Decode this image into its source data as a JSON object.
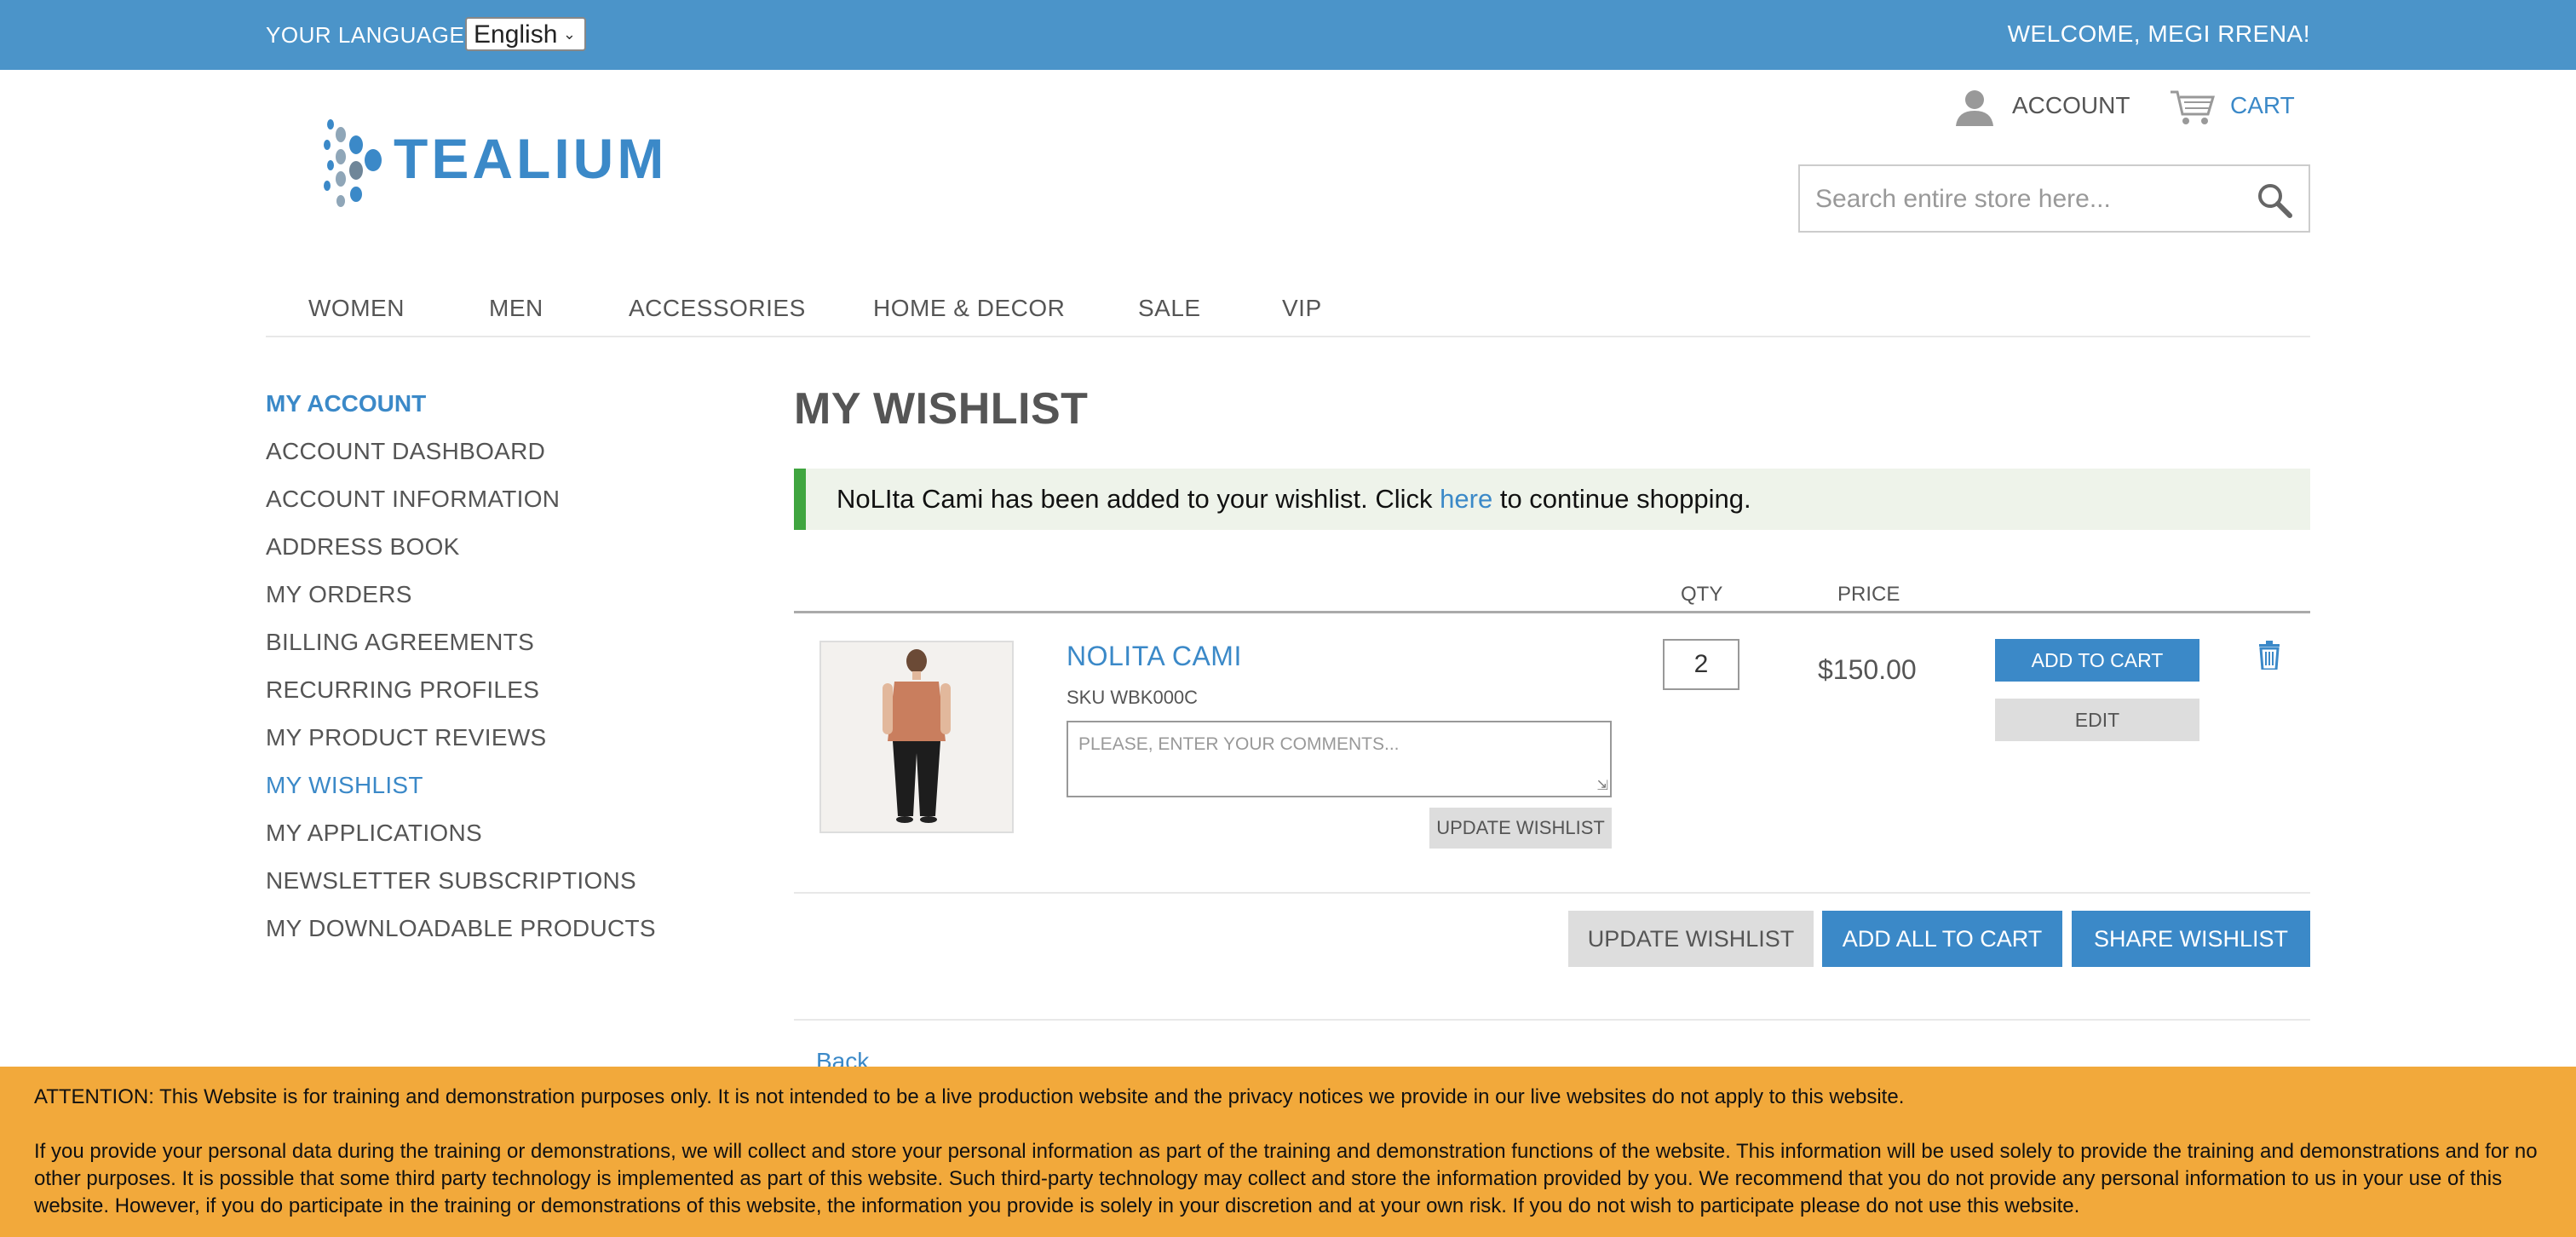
{
  "topbar": {
    "language_label": "YOUR LANGUAGE:",
    "language_selected": "English",
    "welcome": "WELCOME, MEGI RRENA!"
  },
  "header": {
    "logo_text": "TEALIUM",
    "account_label": "ACCOUNT",
    "cart_label": "CART",
    "search_placeholder": "Search entire store here..."
  },
  "nav": {
    "items": [
      "WOMEN",
      "MEN",
      "ACCESSORIES",
      "HOME & DECOR",
      "SALE",
      "VIP"
    ]
  },
  "sidebar": {
    "title": "MY ACCOUNT",
    "items": [
      {
        "label": "ACCOUNT DASHBOARD",
        "active": false
      },
      {
        "label": "ACCOUNT INFORMATION",
        "active": false
      },
      {
        "label": "ADDRESS BOOK",
        "active": false
      },
      {
        "label": "MY ORDERS",
        "active": false
      },
      {
        "label": "BILLING AGREEMENTS",
        "active": false
      },
      {
        "label": "RECURRING PROFILES",
        "active": false
      },
      {
        "label": "MY PRODUCT REVIEWS",
        "active": false
      },
      {
        "label": "MY WISHLIST",
        "active": true
      },
      {
        "label": "MY APPLICATIONS",
        "active": false
      },
      {
        "label": "NEWSLETTER SUBSCRIPTIONS",
        "active": false
      },
      {
        "label": "MY DOWNLOADABLE PRODUCTS",
        "active": false
      }
    ]
  },
  "main": {
    "title": "MY WISHLIST",
    "message": {
      "before": "NoLIta Cami has been added to your wishlist. Click ",
      "link": "here",
      "after": " to continue shopping."
    },
    "columns": {
      "qty": "QTY",
      "price": "PRICE"
    },
    "item": {
      "name": "NOLITA CAMI",
      "sku": "SKU WBK000C",
      "comment_placeholder": "PLEASE, ENTER YOUR COMMENTS...",
      "update_label": "UPDATE WISHLIST",
      "qty": "2",
      "price": "$150.00",
      "add_to_cart_label": "ADD TO CART",
      "edit_label": "EDIT"
    },
    "actions": {
      "update_wishlist": "UPDATE WISHLIST",
      "add_all_to_cart": "ADD ALL TO CART",
      "share_wishlist": "SHARE WISHLIST"
    },
    "back_link": "Back"
  },
  "banner": {
    "line1": "ATTENTION: This Website is for training and demonstration purposes only. It is not intended to be a live production website and the privacy notices we provide in our live websites do not apply to this website.",
    "line2": "If you provide your personal data during the training or demonstrations, we will collect and store your personal information as part of the training and demonstration functions of the website. This information will be used solely to provide the training and demonstrations and for no other purposes. It is possible that some third party technology is implemented as part of this website. Such third-party technology may collect and store the information provided by you. We recommend that you do not provide any personal information to us in your use of this website. However, if you do participate in the training or demonstrations of this website, the information you provide is solely in your discretion and at your own risk. If you do not wish to participate please do not use this website."
  },
  "colors": {
    "topbar": "#4b94c9",
    "accent": "#3b89c8",
    "success_border": "#3fa53f",
    "banner": "#f2a93b"
  },
  "icons": [
    "user-icon",
    "cart-icon",
    "search-icon",
    "trash-icon",
    "chevron-down-icon"
  ]
}
